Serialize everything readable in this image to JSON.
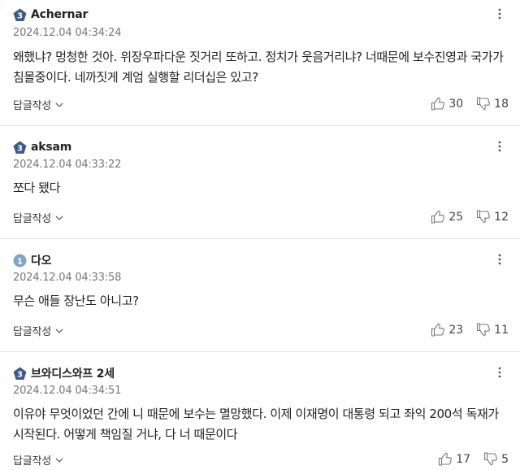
{
  "comments": [
    {
      "level": "3",
      "nick": "Achernar",
      "date": "2024.12.04 04:34:24",
      "text": "왜했냐? 멍청한 것아. 위장우파다운 짓거리 또하고. 정치가 웃음거리냐? 너때문에 보수진영과 국가가 침몰중이다. 네까짓게 계엄 실행할 리더십은 있고?",
      "reply_label": "답글작성",
      "likes": "30",
      "dislikes": "18"
    },
    {
      "level": "3",
      "nick": "aksam",
      "date": "2024.12.04 04:33:22",
      "text": "쪼다 됐다",
      "reply_label": "답글작성",
      "likes": "25",
      "dislikes": "12"
    },
    {
      "level": "1",
      "nick": "다오",
      "date": "2024.12.04 04:33:58",
      "text": "무슨 애들 장난도 아니고?",
      "reply_label": "답글작성",
      "likes": "23",
      "dislikes": "11"
    },
    {
      "level": "3",
      "nick": "브와디스와프 2세",
      "date": "2024.12.04 04:34:51",
      "text": "이유야 무엇이었던 간에 니 때문에 보수는 멸망했다. 이제 이재명이 대통령 되고 좌익 200석 독재가 시작된다. 어떻게 책임질 거냐, 다 너 때문이다",
      "reply_label": "답글작성",
      "likes": "17",
      "dislikes": "5"
    }
  ],
  "colors": {
    "level3": "#3d5b8c",
    "level1": "#7fa6c8",
    "divider": "#e4e4e4",
    "date": "#777777"
  },
  "icons": {
    "level_badge": "pentagon-level-badge-icon",
    "more": "kebab-menu-icon",
    "chevron": "chevron-down-icon",
    "like": "thumbs-up-icon",
    "dislike": "thumbs-down-icon"
  }
}
